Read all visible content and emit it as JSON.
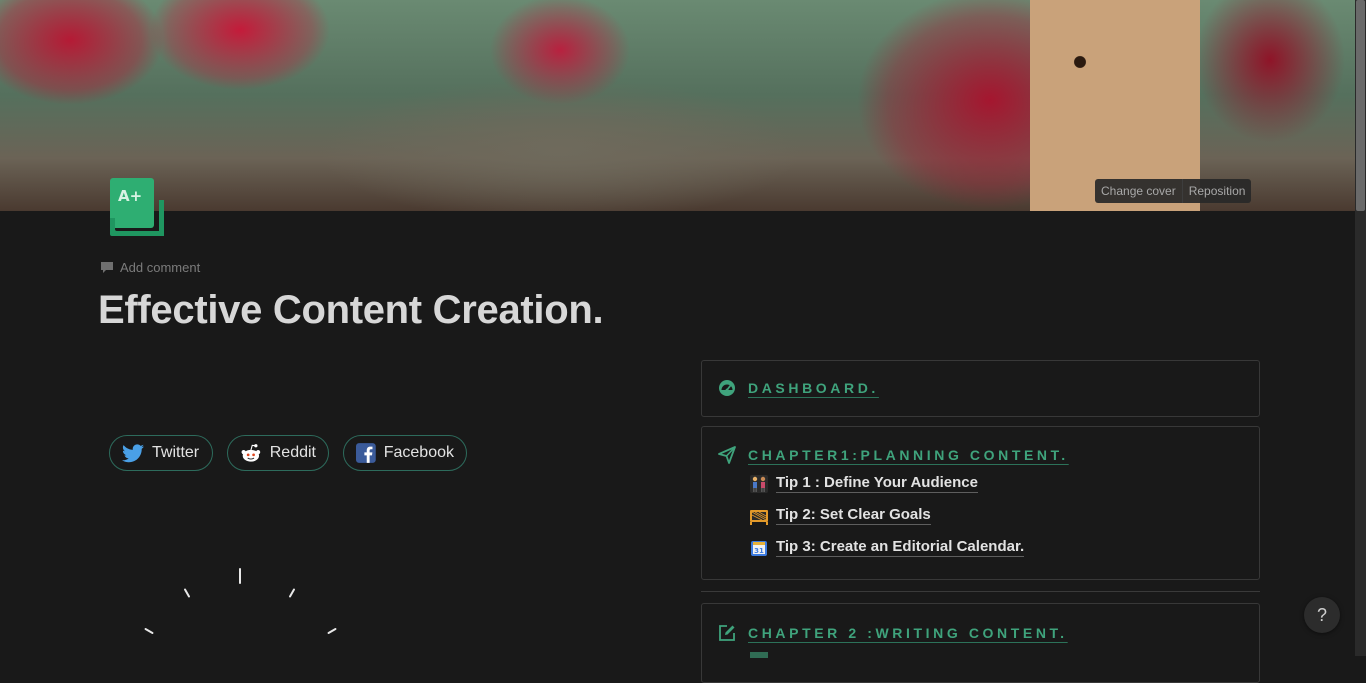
{
  "cover": {
    "change_label": "Change cover",
    "reposition_label": "Reposition"
  },
  "page": {
    "add_comment": "Add comment",
    "title": "Effective Content Creation."
  },
  "social": [
    {
      "label": "Twitter",
      "icon": "twitter-icon"
    },
    {
      "label": "Reddit",
      "icon": "reddit-icon"
    },
    {
      "label": "Facebook",
      "icon": "facebook-icon"
    }
  ],
  "sections": {
    "dashboard": {
      "title": "DASHBOARD.",
      "icon": "dashboard-gauge-icon"
    },
    "chapter1": {
      "title": "CHAPTER1:PLANNING CONTENT.",
      "icon": "paper-plane-icon",
      "tips": [
        {
          "label": "Tip 1 : Define Your Audience",
          "icon": "people-icon"
        },
        {
          "label": "Tip 2: Set Clear Goals",
          "icon": "goal-icon"
        },
        {
          "label": "Tip 3: Create an Editorial Calendar.",
          "icon": "calendar-icon"
        }
      ]
    },
    "chapter2": {
      "title": "CHAPTER 2 :WRITING CONTENT.",
      "icon": "edit-icon"
    }
  },
  "help": "?",
  "colors": {
    "accent": "#3fa37c",
    "background": "#191919",
    "border": "#383838"
  }
}
